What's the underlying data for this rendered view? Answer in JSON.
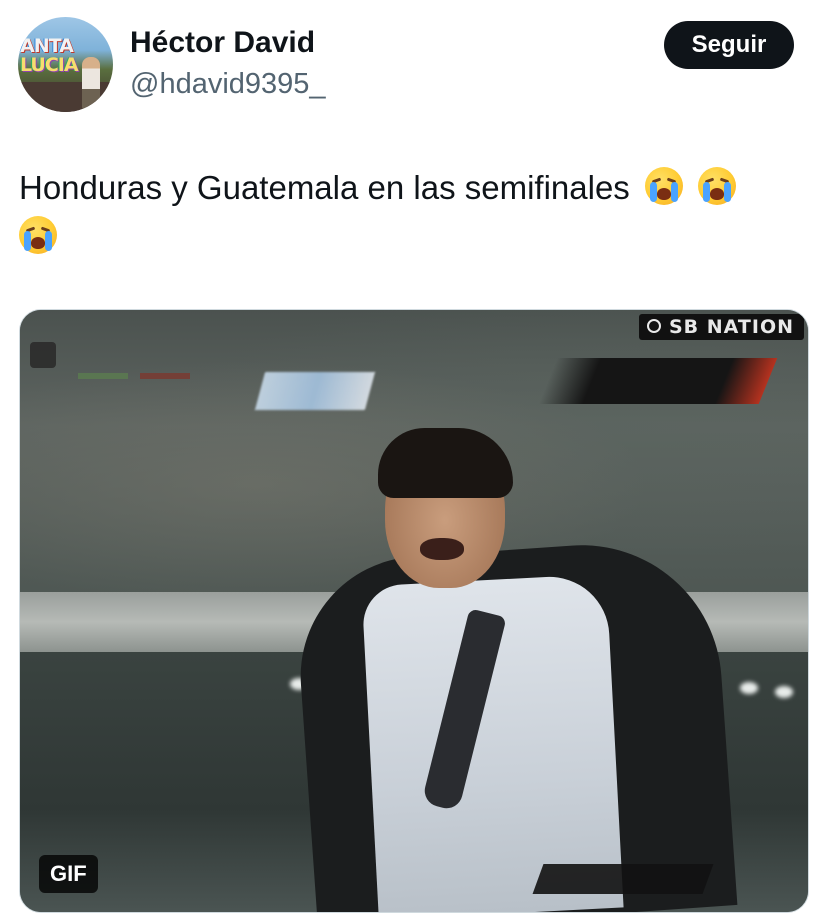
{
  "author": {
    "display_name": "Héctor David",
    "handle": "@hdavid9395_",
    "avatar_sign_line1": "ANTA",
    "avatar_sign_line2": "LUCIA"
  },
  "follow_button": {
    "label": "Seguir"
  },
  "tweet": {
    "text": "Honduras y Guatemala en las semifinales",
    "emojis": [
      "loudly-crying-face",
      "loudly-crying-face",
      "loudly-crying-face"
    ]
  },
  "media": {
    "type": "gif",
    "badge": "GIF",
    "watermark": "SB NATION"
  },
  "colors": {
    "follow_bg": "#0f1419",
    "text_primary": "#0f1419",
    "text_secondary": "#536471"
  }
}
